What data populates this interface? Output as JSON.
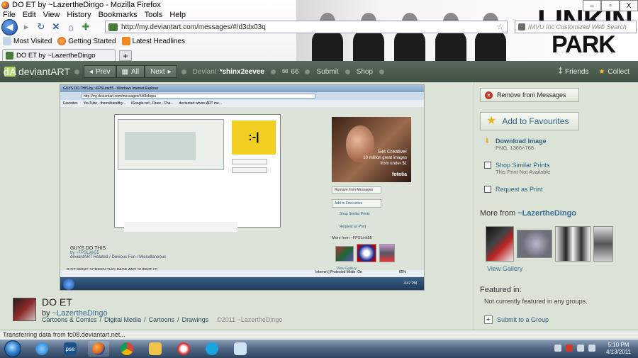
{
  "window": {
    "title": "DO ET by ~LazertheDingo - Mozilla Firefox",
    "buttons": [
      "–",
      "▫",
      "X"
    ]
  },
  "menubar": [
    "File",
    "Edit",
    "View",
    "History",
    "Bookmarks",
    "Tools",
    "Help"
  ],
  "navbar": {
    "url": "http://my.deviantart.com/messages/#/d3dx03q",
    "search_placeholder": "IMVU Inc Customized Web Search"
  },
  "bookmarks": [
    "Most Visited",
    "Getting Started",
    "Latest Headlines"
  ],
  "tab": {
    "label": "DO ET by ~LazertheDingo",
    "new_tab": "+"
  },
  "banner": {
    "logo_line1": "LINKIN",
    "logo_line2": "PARK"
  },
  "da_header": {
    "logo": "deviantART",
    "prev": "Prev",
    "all": "All",
    "next": "Next",
    "user_prefix": "Deviant",
    "username": "*shinx2eevee",
    "messages_count": "66",
    "submit": "Submit",
    "shop": "Shop",
    "friends": "Friends",
    "collect": "Collect"
  },
  "embedded_screenshot": {
    "ie_title": "GUYS DO THIS by ~FPSLink55 - Windows Internet Explorer",
    "ie_url": "http://my.deviantart.com/messages/#/d3ebqsu",
    "ie_favorites": [
      "Favorites",
      "YouTube - theevilstealthy...",
      "iGoogle.net - Draw - Cha...",
      "deviantart where ART me..."
    ],
    "ie_nested_title": "GUYS DO THIS",
    "ie_nested_by": "by ~FPSLink55",
    "ie_nested_cats": "deviantART Related / Devious Fun / Miscellaneous",
    "ie_caption": "JUST PRINT SCREEN THIS PAGE AND SUBMIT IT!",
    "ie_remove": "Remove from Messages",
    "ie_fav": "Add to Favourites",
    "ie_shop": "Shop Similar Prints",
    "ie_request": "Request as Print",
    "ie_more": "More from ~FPSLink55",
    "ie_view_gallery": "View Gallery",
    "ie_status": "Internet | Protected Mode: On",
    "ie_zoom": "65%",
    "ie_clock": "4:47 PM",
    "ad_line1": "Get Creative!",
    "ad_line2": "10 million great images",
    "ad_line3": "from under $1",
    "ad_brand": "fotolia",
    "emoticon": ":-|"
  },
  "deviation": {
    "title": "DO ET",
    "by": "by",
    "author": "~LazertheDingo",
    "categories": [
      "Cartoons & Comics",
      "Digital Media",
      "Cartoons",
      "Drawings"
    ],
    "copyright": "©2011 ~LazertheDingo"
  },
  "right_pane": {
    "remove_label": "Remove from Messages",
    "fav_label": "Add to Favourites",
    "download_label": "Download Image",
    "download_meta": "PNG, 1366×768",
    "shop_label": "Shop Similar Prints",
    "shop_meta": "This Print Not Available",
    "request_label": "Request as Print",
    "more_from_prefix": "More from",
    "more_from_author": "~LazertheDingo",
    "view_gallery": "View Gallery",
    "featured_heading": "Featured in:",
    "featured_none": "Not currently featured in any groups.",
    "submit_group": "Submit to a Group"
  },
  "status_bar": "Transferring data from fc08.deviantart.net...",
  "taskbar": {
    "time": "5:10 PM",
    "date": "4/13/2011"
  },
  "colors": {
    "da_header": "#4b5c4e",
    "da_bg": "#dbe3d6",
    "link": "#3b6e98",
    "accent_green": "#b6d46a"
  }
}
